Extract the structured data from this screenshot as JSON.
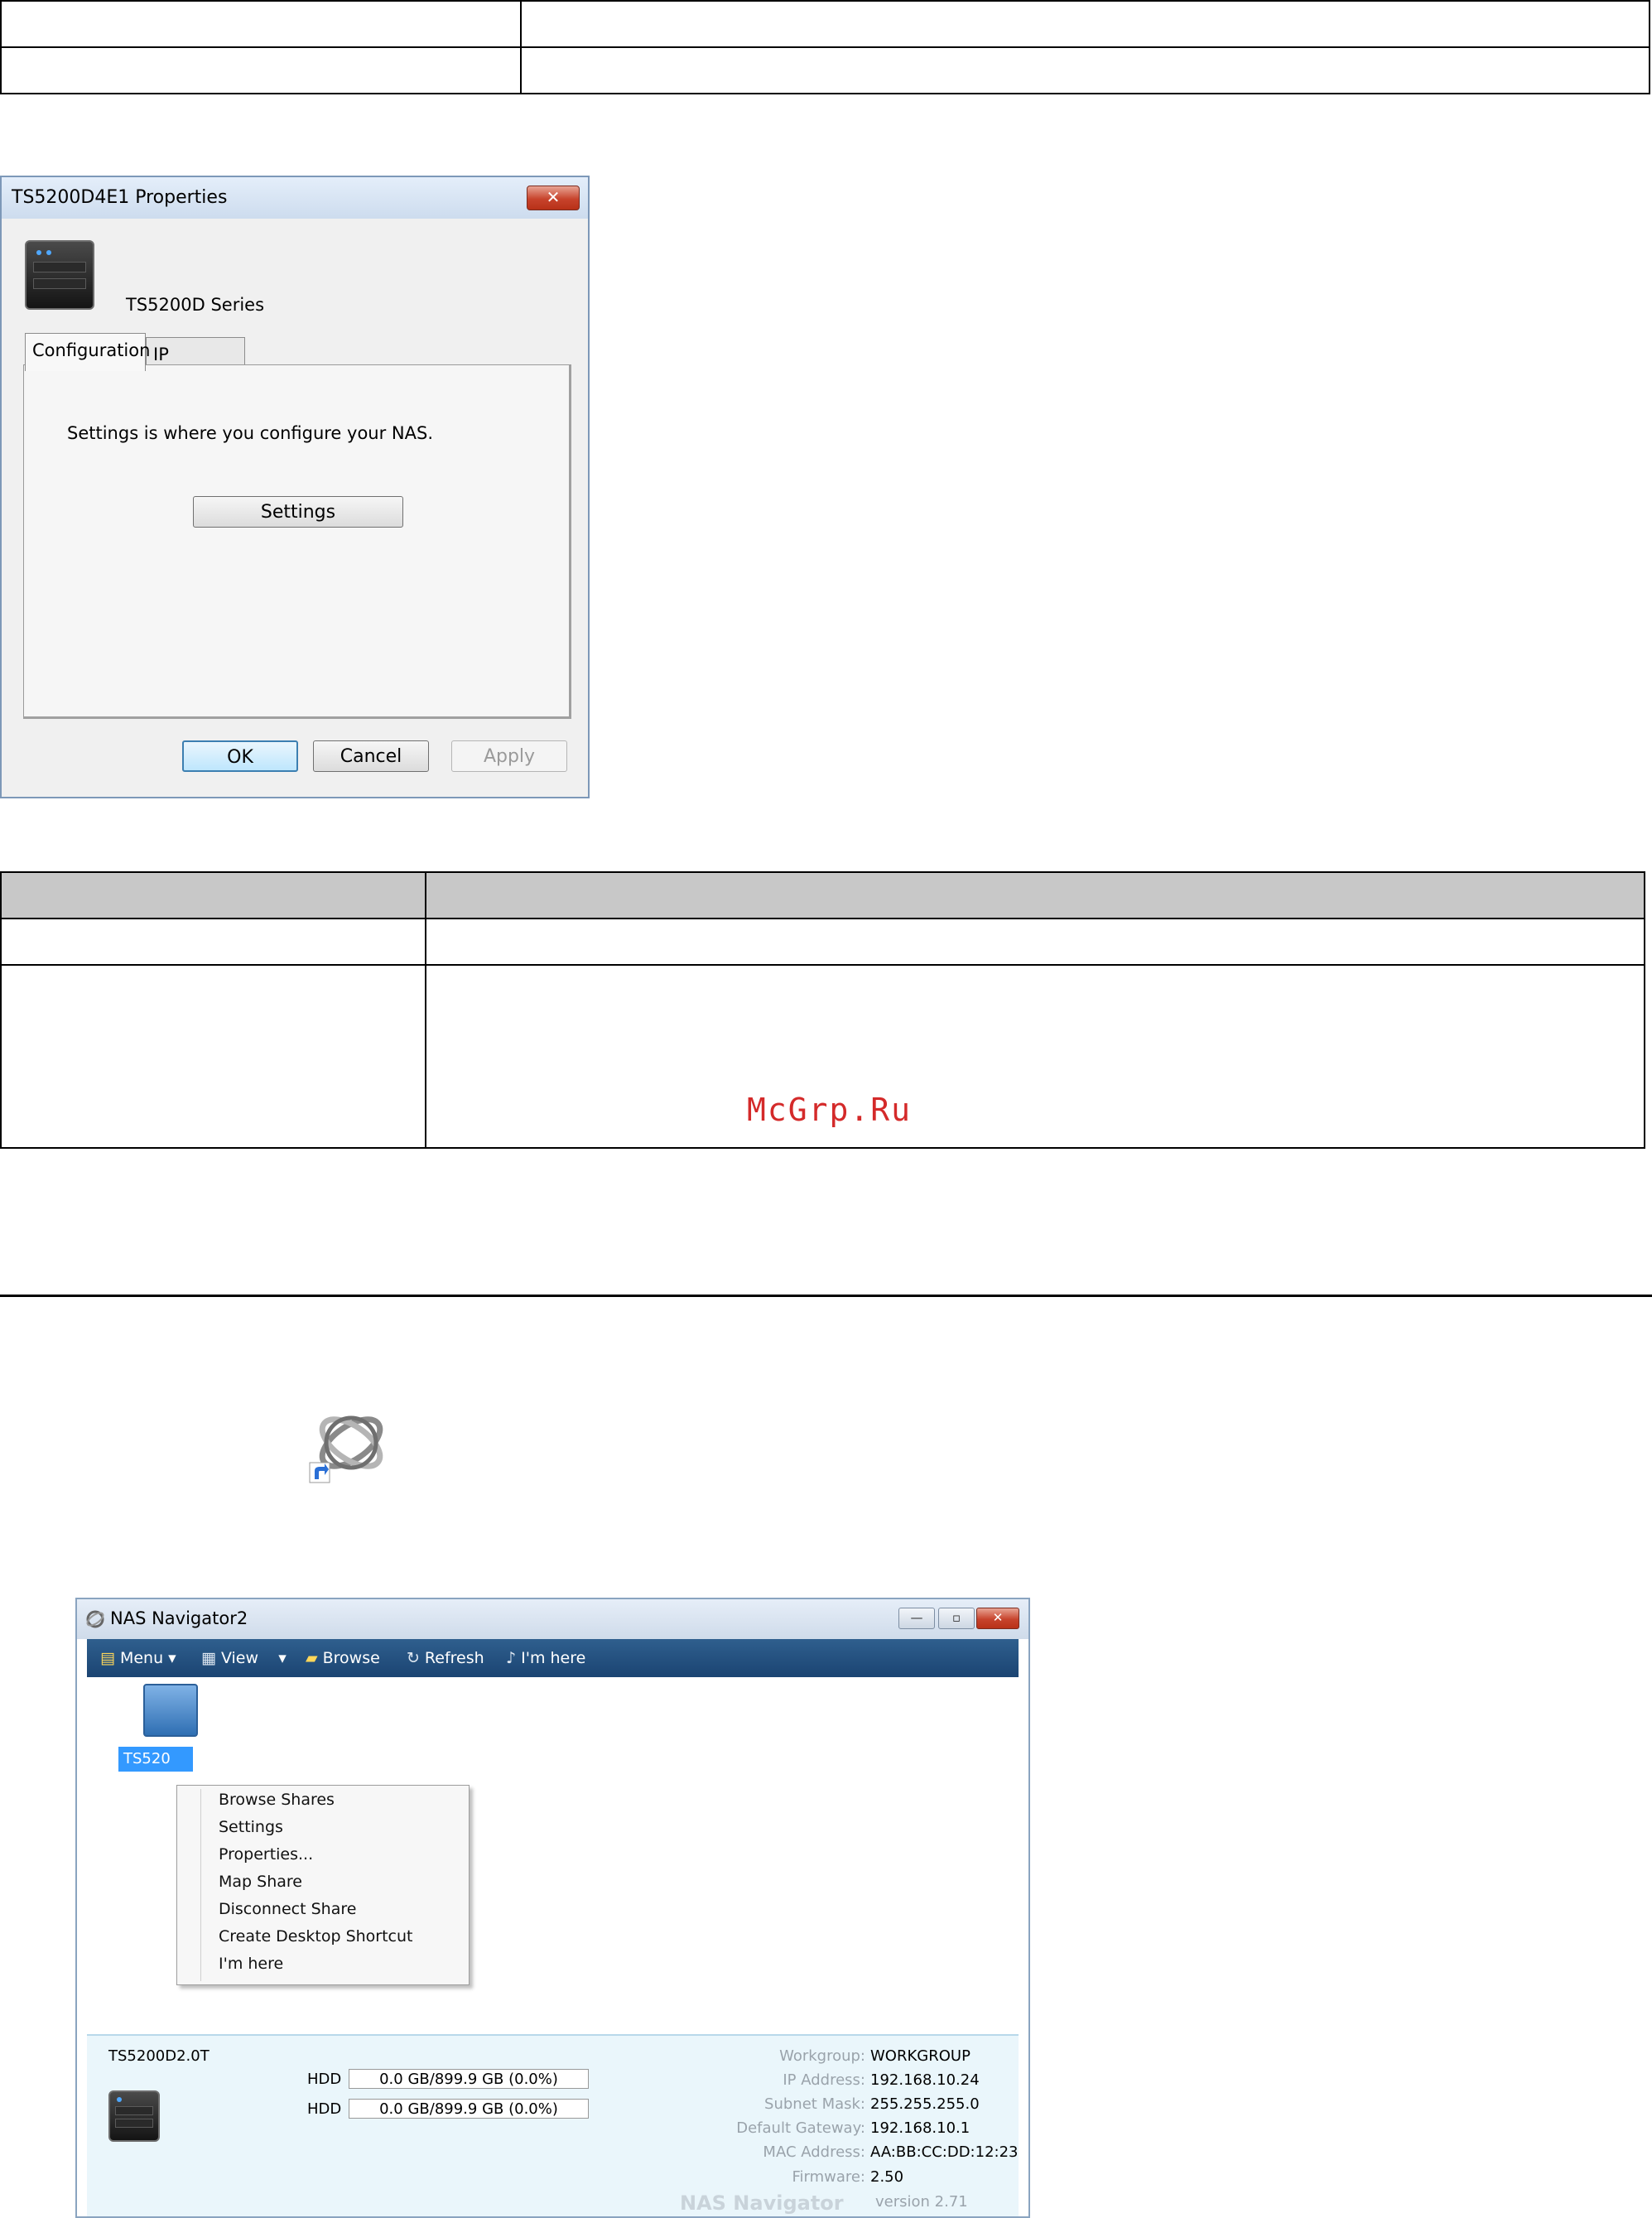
{
  "properties_dialog": {
    "title": "TS5200D4E1 Properties",
    "close_glyph": "✕",
    "device_series": "TS5200D Series",
    "tabs": [
      {
        "label": "Configuration",
        "active": true
      },
      {
        "label": "IP Address",
        "active": false
      }
    ],
    "description": "Settings is where you configure your NAS.",
    "settings_button": "Settings",
    "buttons": {
      "ok": "OK",
      "cancel": "Cancel",
      "apply": "Apply"
    }
  },
  "watermark": "McGrp.Ru",
  "nas_navigator": {
    "title": "NAS Navigator2",
    "window_controls": {
      "minimize": "—",
      "maximize": "▫",
      "close": "✕"
    },
    "toolbar": [
      {
        "label": "Menu",
        "icon": "document-icon",
        "dropdown": true
      },
      {
        "label": "View",
        "icon": "grid-icon",
        "dropdown": true
      },
      {
        "label": "Browse",
        "icon": "folder-icon",
        "dropdown": false
      },
      {
        "label": "Refresh",
        "icon": "refresh-icon",
        "dropdown": false
      },
      {
        "label": "I'm here",
        "icon": "music-note-icon",
        "dropdown": false
      }
    ],
    "selected_device_label": "TS520",
    "context_menu": [
      "Browse Shares",
      "Settings",
      "Properties...",
      "Map Share",
      "Disconnect Share",
      "Create Desktop Shortcut",
      "I'm here"
    ],
    "info": {
      "device_name": "TS5200D2.0T",
      "hdd": [
        {
          "label": "HDD",
          "usage": "0.0 GB/899.9 GB (0.0%)"
        },
        {
          "label": "HDD",
          "usage": "0.0 GB/899.9 GB (0.0%)"
        }
      ],
      "fields": [
        {
          "label": "Workgroup:",
          "value": "WORKGROUP"
        },
        {
          "label": "IP Address:",
          "value": "192.168.10.24"
        },
        {
          "label": "Subnet Mask:",
          "value": "255.255.255.0"
        },
        {
          "label": "Default Gateway:",
          "value": "192.168.10.1"
        },
        {
          "label": "MAC Address:",
          "value": "AA:BB:CC:DD:12:23"
        },
        {
          "label": "Firmware:",
          "value": "2.50"
        }
      ],
      "brand": "NAS Navigator",
      "version": "version 2.71"
    }
  }
}
